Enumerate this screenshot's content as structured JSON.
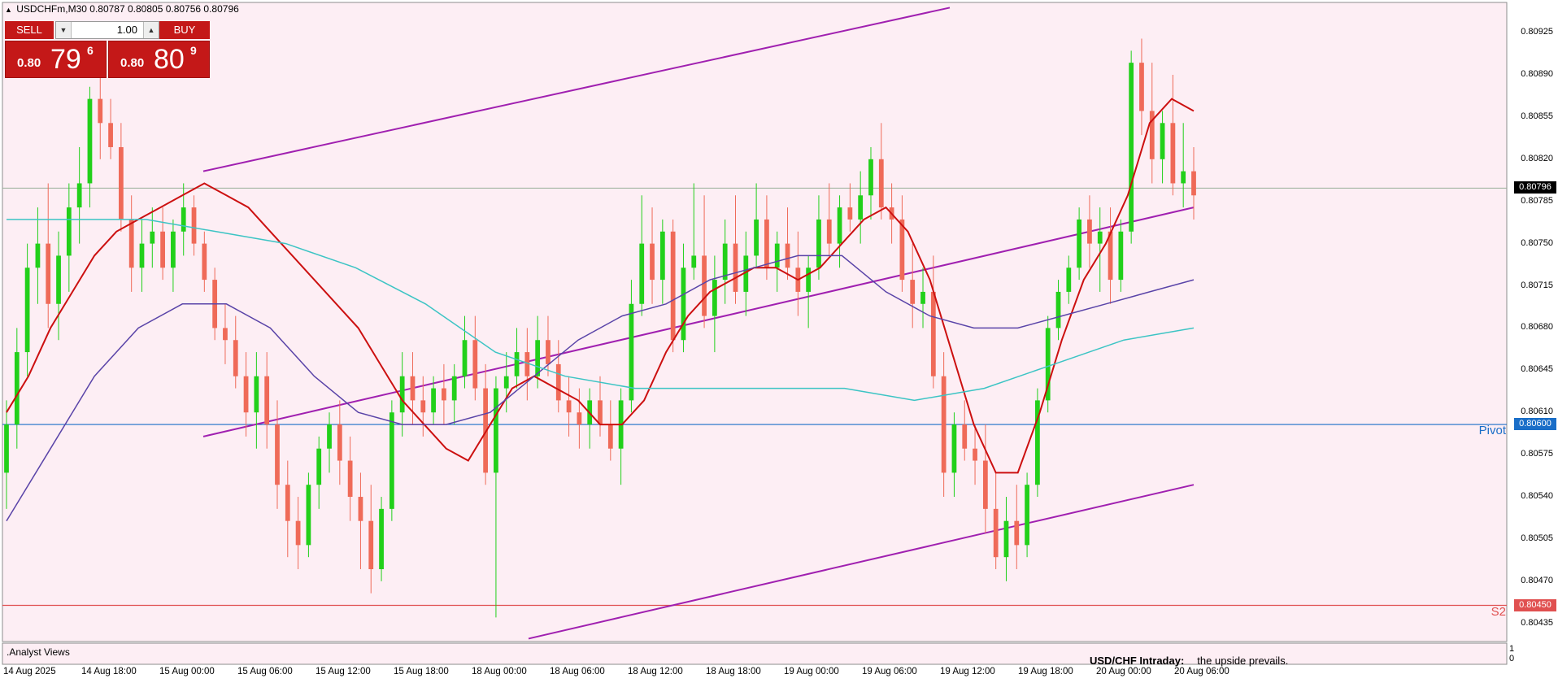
{
  "symbol": {
    "title": "USDCHFm,M30",
    "ohlc": "0.80787 0.80805 0.80756 0.80796"
  },
  "trade_panel": {
    "sell_label": "SELL",
    "buy_label": "BUY",
    "volume": "1.00",
    "bid": {
      "prefix": "0.80",
      "big": "79",
      "sup": "6"
    },
    "ask": {
      "prefix": "0.80",
      "big": "80",
      "sup": "9"
    }
  },
  "colors": {
    "background": "#fdeef4",
    "bull": "#22d01a",
    "bear": "#ef6a58",
    "ema_red": "#cc1010",
    "ma_purple": "#5a44a8",
    "ma_cyan": "#3cc4c4",
    "channel": "#a020b0",
    "pivot": "#1a6ec8",
    "s2": "#e05050",
    "current_line": "#9ab09a"
  },
  "levels": {
    "current": {
      "value": 0.80796,
      "label": "0.80796"
    },
    "pivot": {
      "value": 0.806,
      "label": "0.80600",
      "name": "Pivot"
    },
    "s2": {
      "value": 0.8045,
      "label": "0.80450",
      "name": "S2"
    }
  },
  "indicator_window": {
    "name": ".Analyst Views",
    "scale_top": "1",
    "scale_bottom": "0",
    "headline": "USD/CHF Intraday:",
    "text": "the upside prevails."
  },
  "chart_data": {
    "type": "candlestick",
    "title": "USDCHFm,M30",
    "ylim": [
      0.8042,
      0.8095
    ],
    "y_ticks": [
      "0.80925",
      "0.80890",
      "0.80855",
      "0.80820",
      "0.80785",
      "0.80750",
      "0.80715",
      "0.80680",
      "0.80645",
      "0.80610",
      "0.80575",
      "0.80540",
      "0.80505",
      "0.80470",
      "0.80435"
    ],
    "x_ticks": [
      "14 Aug 2025",
      "14 Aug 18:00",
      "15 Aug 00:00",
      "15 Aug 06:00",
      "15 Aug 12:00",
      "15 Aug 18:00",
      "18 Aug 00:00",
      "18 Aug 06:00",
      "18 Aug 12:00",
      "18 Aug 18:00",
      "19 Aug 00:00",
      "19 Aug 06:00",
      "19 Aug 12:00",
      "19 Aug 18:00",
      "20 Aug 00:00",
      "20 Aug 06:00"
    ],
    "candles": [
      [
        0.8056,
        0.8062,
        0.8053,
        0.806
      ],
      [
        0.806,
        0.8068,
        0.8058,
        0.8066
      ],
      [
        0.8066,
        0.8075,
        0.8064,
        0.8073
      ],
      [
        0.8073,
        0.8078,
        0.807,
        0.8075
      ],
      [
        0.8075,
        0.808,
        0.8068,
        0.807
      ],
      [
        0.807,
        0.8076,
        0.8067,
        0.8074
      ],
      [
        0.8074,
        0.808,
        0.8071,
        0.8078
      ],
      [
        0.8078,
        0.8083,
        0.8075,
        0.808
      ],
      [
        0.808,
        0.8088,
        0.8078,
        0.8087
      ],
      [
        0.8087,
        0.809,
        0.8082,
        0.8085
      ],
      [
        0.8085,
        0.8087,
        0.8082,
        0.8083
      ],
      [
        0.8083,
        0.8085,
        0.8076,
        0.8077
      ],
      [
        0.8077,
        0.8079,
        0.8071,
        0.8073
      ],
      [
        0.8073,
        0.8077,
        0.8071,
        0.8075
      ],
      [
        0.8075,
        0.8078,
        0.8073,
        0.8076
      ],
      [
        0.8076,
        0.8078,
        0.8072,
        0.8073
      ],
      [
        0.8073,
        0.8077,
        0.8071,
        0.8076
      ],
      [
        0.8076,
        0.808,
        0.8074,
        0.8078
      ],
      [
        0.8078,
        0.8079,
        0.8074,
        0.8075
      ],
      [
        0.8075,
        0.8076,
        0.8071,
        0.8072
      ],
      [
        0.8072,
        0.8073,
        0.8067,
        0.8068
      ],
      [
        0.8068,
        0.807,
        0.8065,
        0.8067
      ],
      [
        0.8067,
        0.8069,
        0.8063,
        0.8064
      ],
      [
        0.8064,
        0.8066,
        0.8059,
        0.8061
      ],
      [
        0.8061,
        0.8066,
        0.8058,
        0.8064
      ],
      [
        0.8064,
        0.8066,
        0.8058,
        0.806
      ],
      [
        0.806,
        0.8062,
        0.8053,
        0.8055
      ],
      [
        0.8055,
        0.8057,
        0.8049,
        0.8052
      ],
      [
        0.8052,
        0.8054,
        0.8048,
        0.805
      ],
      [
        0.805,
        0.8056,
        0.8049,
        0.8055
      ],
      [
        0.8055,
        0.8059,
        0.8053,
        0.8058
      ],
      [
        0.8058,
        0.8061,
        0.8056,
        0.806
      ],
      [
        0.806,
        0.8062,
        0.8055,
        0.8057
      ],
      [
        0.8057,
        0.8059,
        0.8052,
        0.8054
      ],
      [
        0.8054,
        0.8056,
        0.8048,
        0.8052
      ],
      [
        0.8052,
        0.8055,
        0.8046,
        0.8048
      ],
      [
        0.8048,
        0.8054,
        0.8047,
        0.8053
      ],
      [
        0.8053,
        0.8062,
        0.8052,
        0.8061
      ],
      [
        0.8061,
        0.8066,
        0.8059,
        0.8064
      ],
      [
        0.8064,
        0.8066,
        0.806,
        0.8062
      ],
      [
        0.8062,
        0.8064,
        0.8059,
        0.8061
      ],
      [
        0.8061,
        0.8064,
        0.806,
        0.8063
      ],
      [
        0.8063,
        0.8065,
        0.806,
        0.8062
      ],
      [
        0.8062,
        0.8065,
        0.806,
        0.8064
      ],
      [
        0.8064,
        0.8069,
        0.8063,
        0.8067
      ],
      [
        0.8067,
        0.8069,
        0.8062,
        0.8063
      ],
      [
        0.8063,
        0.8065,
        0.8055,
        0.8056
      ],
      [
        0.8056,
        0.8064,
        0.8044,
        0.8063
      ],
      [
        0.8063,
        0.8066,
        0.8061,
        0.8064
      ],
      [
        0.8064,
        0.8068,
        0.8063,
        0.8066
      ],
      [
        0.8066,
        0.8068,
        0.8062,
        0.8064
      ],
      [
        0.8064,
        0.8069,
        0.8063,
        0.8067
      ],
      [
        0.8067,
        0.8069,
        0.8064,
        0.8065
      ],
      [
        0.8065,
        0.8067,
        0.8061,
        0.8062
      ],
      [
        0.8062,
        0.8064,
        0.8059,
        0.8061
      ],
      [
        0.8061,
        0.8063,
        0.8058,
        0.806
      ],
      [
        0.806,
        0.8063,
        0.8058,
        0.8062
      ],
      [
        0.8062,
        0.8064,
        0.8059,
        0.806
      ],
      [
        0.806,
        0.8062,
        0.8057,
        0.8058
      ],
      [
        0.8058,
        0.8063,
        0.8055,
        0.8062
      ],
      [
        0.8062,
        0.8072,
        0.8061,
        0.807
      ],
      [
        0.807,
        0.8079,
        0.8069,
        0.8075
      ],
      [
        0.8075,
        0.8078,
        0.807,
        0.8072
      ],
      [
        0.8072,
        0.8077,
        0.807,
        0.8076
      ],
      [
        0.8076,
        0.8077,
        0.8066,
        0.8067
      ],
      [
        0.8067,
        0.8075,
        0.8066,
        0.8073
      ],
      [
        0.8073,
        0.808,
        0.8072,
        0.8074
      ],
      [
        0.8074,
        0.8079,
        0.8068,
        0.8069
      ],
      [
        0.8069,
        0.8074,
        0.8066,
        0.8072
      ],
      [
        0.8072,
        0.8077,
        0.807,
        0.8075
      ],
      [
        0.8075,
        0.8079,
        0.807,
        0.8071
      ],
      [
        0.8071,
        0.8076,
        0.8069,
        0.8074
      ],
      [
        0.8074,
        0.808,
        0.8073,
        0.8077
      ],
      [
        0.8077,
        0.8079,
        0.8072,
        0.8073
      ],
      [
        0.8073,
        0.8076,
        0.8071,
        0.8075
      ],
      [
        0.8075,
        0.8078,
        0.8072,
        0.8073
      ],
      [
        0.8073,
        0.8076,
        0.8069,
        0.8071
      ],
      [
        0.8071,
        0.8074,
        0.8068,
        0.8073
      ],
      [
        0.8073,
        0.8079,
        0.8072,
        0.8077
      ],
      [
        0.8077,
        0.808,
        0.8074,
        0.8075
      ],
      [
        0.8075,
        0.8079,
        0.8073,
        0.8078
      ],
      [
        0.8078,
        0.808,
        0.8076,
        0.8077
      ],
      [
        0.8077,
        0.8081,
        0.8075,
        0.8079
      ],
      [
        0.8079,
        0.8083,
        0.8077,
        0.8082
      ],
      [
        0.8082,
        0.8085,
        0.8077,
        0.8078
      ],
      [
        0.8078,
        0.808,
        0.8075,
        0.8077
      ],
      [
        0.8077,
        0.8079,
        0.8071,
        0.8072
      ],
      [
        0.8072,
        0.8075,
        0.8068,
        0.807
      ],
      [
        0.807,
        0.8073,
        0.8068,
        0.8071
      ],
      [
        0.8071,
        0.8074,
        0.8063,
        0.8064
      ],
      [
        0.8064,
        0.8066,
        0.8054,
        0.8056
      ],
      [
        0.8056,
        0.8061,
        0.8054,
        0.806
      ],
      [
        0.806,
        0.8062,
        0.8057,
        0.8058
      ],
      [
        0.8058,
        0.806,
        0.8055,
        0.8057
      ],
      [
        0.8057,
        0.806,
        0.8051,
        0.8053
      ],
      [
        0.8053,
        0.8056,
        0.8048,
        0.8049
      ],
      [
        0.8049,
        0.8054,
        0.8047,
        0.8052
      ],
      [
        0.8052,
        0.8055,
        0.8048,
        0.805
      ],
      [
        0.805,
        0.8056,
        0.8049,
        0.8055
      ],
      [
        0.8055,
        0.8063,
        0.8054,
        0.8062
      ],
      [
        0.8062,
        0.8069,
        0.8061,
        0.8068
      ],
      [
        0.8068,
        0.8072,
        0.8067,
        0.8071
      ],
      [
        0.8071,
        0.8074,
        0.807,
        0.8073
      ],
      [
        0.8073,
        0.8078,
        0.8072,
        0.8077
      ],
      [
        0.8077,
        0.8079,
        0.8073,
        0.8075
      ],
      [
        0.8075,
        0.8078,
        0.8071,
        0.8076
      ],
      [
        0.8076,
        0.8078,
        0.807,
        0.8072
      ],
      [
        0.8072,
        0.8077,
        0.8071,
        0.8076
      ],
      [
        0.8076,
        0.8091,
        0.8075,
        0.809
      ],
      [
        0.809,
        0.8092,
        0.8084,
        0.8086
      ],
      [
        0.8086,
        0.809,
        0.808,
        0.8082
      ],
      [
        0.8082,
        0.8086,
        0.808,
        0.8085
      ],
      [
        0.8085,
        0.8089,
        0.8079,
        0.808
      ],
      [
        0.808,
        0.8085,
        0.8078,
        0.8081
      ],
      [
        0.8081,
        0.8083,
        0.8077,
        0.8079
      ]
    ],
    "series": [
      {
        "type": "line",
        "values": [
          0.8061,
          0.8064,
          0.8068,
          0.8071,
          0.8074,
          0.8076,
          0.8077,
          0.8078,
          0.8079,
          0.808,
          0.8079,
          0.8078,
          0.8076,
          0.8074,
          0.8072,
          0.807,
          0.8068,
          0.8065,
          0.8062,
          0.806,
          0.8058,
          0.8057,
          0.806,
          0.8063,
          0.8064,
          0.8063,
          0.8062,
          0.806,
          0.806,
          0.8062,
          0.8066,
          0.8069,
          0.8071,
          0.8072,
          0.8073,
          0.8073,
          0.8072,
          0.8073,
          0.8075,
          0.8077,
          0.8078,
          0.8076,
          0.8072,
          0.8066,
          0.806,
          0.8056,
          0.8056,
          0.8061,
          0.8067,
          0.8072,
          0.8075,
          0.8079,
          0.8085,
          0.8087,
          0.8086
        ]
      },
      {
        "type": "line",
        "values": [
          0.8052,
          0.8058,
          0.8064,
          0.8068,
          0.807,
          0.807,
          0.8068,
          0.8064,
          0.8061,
          0.806,
          0.806,
          0.8061,
          0.8064,
          0.8067,
          0.8069,
          0.807,
          0.8072,
          0.8073,
          0.8074,
          0.8074,
          0.8071,
          0.8069,
          0.8068,
          0.8068,
          0.8069,
          0.807,
          0.8071,
          0.8072
        ]
      },
      {
        "type": "line",
        "values": [
          0.8077,
          0.8077,
          0.8077,
          0.8076,
          0.8075,
          0.8073,
          0.807,
          0.8066,
          0.8064,
          0.8063,
          0.8063,
          0.8063,
          0.8063,
          0.8062,
          0.8063,
          0.8065,
          0.8067,
          0.8068
        ]
      }
    ]
  }
}
